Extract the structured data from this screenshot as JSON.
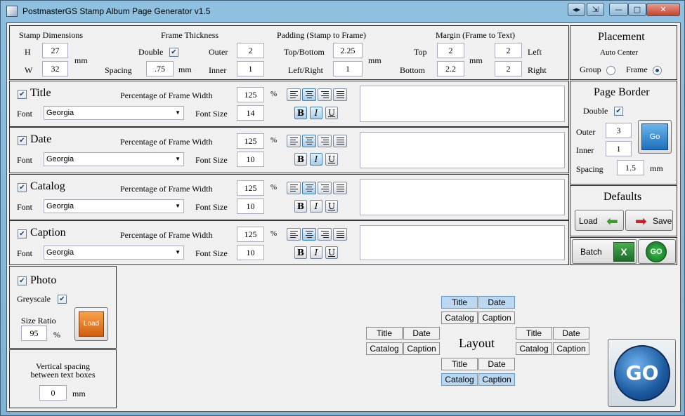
{
  "window": {
    "title": "PostmasterGS Stamp Album Page Generator v1.5"
  },
  "stamp_dimensions": {
    "heading": "Stamp Dimensions",
    "h_label": "H",
    "h_value": "27",
    "w_label": "W",
    "w_value": "32",
    "unit": "mm"
  },
  "frame_thickness": {
    "heading": "Frame Thickness",
    "double_label": "Double",
    "double_checked": true,
    "outer_label": "Outer",
    "outer_value": "2",
    "inner_label": "Inner",
    "inner_value": "1",
    "spacing_label": "Spacing",
    "spacing_value": ".75",
    "spacing_unit": "mm"
  },
  "padding": {
    "heading": "Padding (Stamp to Frame)",
    "top_bottom_label": "Top/Bottom",
    "top_bottom_value": "2.25",
    "left_right_label": "Left/Right",
    "left_right_value": "1",
    "unit": "mm"
  },
  "margin": {
    "heading": "Margin (Frame to Text)",
    "top_label": "Top",
    "top_value": "2",
    "bottom_label": "Bottom",
    "bottom_value": "2.2",
    "unit": "mm",
    "left_label": "Left",
    "left_value": "2",
    "right_label": "Right",
    "right_value": "2"
  },
  "placement": {
    "heading": "Placement",
    "auto_center": "Auto Center",
    "group_label": "Group",
    "frame_label": "Frame",
    "selected": "Frame"
  },
  "text_sections": [
    {
      "name": "Title",
      "checked": true,
      "pct_label": "Percentage of Frame Width",
      "pct_value": "125",
      "pct_unit": "%",
      "font_label": "Font",
      "font_value": "Georgia",
      "size_label": "Font Size",
      "size_value": "14",
      "align": "center",
      "bold": true,
      "italic": true,
      "underline": false
    },
    {
      "name": "Date",
      "checked": true,
      "pct_label": "Percentage of Frame Width",
      "pct_value": "125",
      "pct_unit": "%",
      "font_label": "Font",
      "font_value": "Georgia",
      "size_label": "Font Size",
      "size_value": "10",
      "align": "center",
      "bold": false,
      "italic": true,
      "underline": false
    },
    {
      "name": "Catalog",
      "checked": true,
      "pct_label": "Percentage of Frame Width",
      "pct_value": "125",
      "pct_unit": "%",
      "font_label": "Font",
      "font_value": "Georgia",
      "size_label": "Font Size",
      "size_value": "10",
      "align": "center",
      "bold": false,
      "italic": false,
      "underline": false
    },
    {
      "name": "Caption",
      "checked": true,
      "pct_label": "Percentage of Frame Width",
      "pct_value": "125",
      "pct_unit": "%",
      "font_label": "Font",
      "font_value": "Georgia",
      "size_label": "Font Size",
      "size_value": "10",
      "align": "center",
      "bold": false,
      "italic": false,
      "underline": false
    }
  ],
  "page_border": {
    "heading": "Page Border",
    "double_label": "Double",
    "double_checked": true,
    "outer_label": "Outer",
    "outer_value": "3",
    "inner_label": "Inner",
    "inner_value": "1",
    "spacing_label": "Spacing",
    "spacing_value": "1.5",
    "spacing_unit": "mm",
    "go_label": "Go"
  },
  "defaults": {
    "heading": "Defaults",
    "load_label": "Load",
    "save_label": "Save"
  },
  "batch": {
    "label": "Batch",
    "go_label": "GO"
  },
  "photo": {
    "label": "Photo",
    "checked": true,
    "greyscale_label": "Greyscale",
    "greyscale_checked": true,
    "size_ratio_label": "Size Ratio",
    "size_ratio_value": "95",
    "size_ratio_unit": "%",
    "load_label": "Load"
  },
  "vertical_spacing": {
    "label_line1": "Vertical spacing",
    "label_line2": "between text boxes",
    "value": "0",
    "unit": "mm"
  },
  "layout": {
    "heading": "Layout",
    "top": [
      [
        "Title",
        "Date"
      ],
      [
        "Catalog",
        "Caption"
      ]
    ],
    "top_selected": [
      true,
      true,
      false,
      false
    ],
    "left": [
      [
        "Title",
        "Date"
      ],
      [
        "Catalog",
        "Caption"
      ]
    ],
    "right": [
      [
        "Title",
        "Date"
      ],
      [
        "Catalog",
        "Caption"
      ]
    ],
    "bottom": [
      [
        "Title",
        "Date"
      ],
      [
        "Catalog",
        "Caption"
      ]
    ],
    "bottom_selected": [
      false,
      false,
      true,
      true
    ]
  },
  "main_go": {
    "label": "GO"
  },
  "colors": {
    "accent_blue": "#1f5f9f",
    "window_frame": "#7fb3d6",
    "selected_layout": "#bcd8f1"
  }
}
